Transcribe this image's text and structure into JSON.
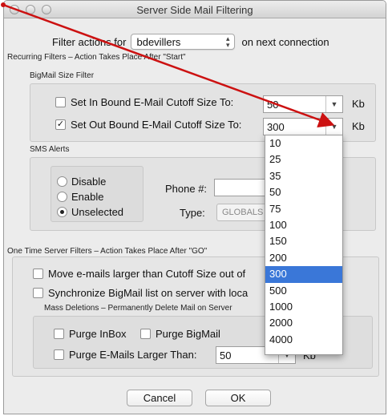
{
  "window": {
    "title": "Server Side Mail Filtering"
  },
  "filter_row": {
    "prefix": "Filter actions for",
    "account": "bdevillers",
    "suffix": "on next connection"
  },
  "recurring": {
    "heading": "Recurring Filters – Action Takes Place After \"Start\"",
    "size_filter": {
      "heading": "BigMail Size Filter",
      "in_label": "Set In Bound E-Mail Cutoff Size To:",
      "in_checked": false,
      "in_value": "50",
      "in_unit": "Kb",
      "out_label": "Set Out Bound E-Mail Cutoff Size To:",
      "out_checked": true,
      "out_value": "300",
      "out_unit": "Kb"
    },
    "sms": {
      "heading": "SMS Alerts",
      "options": [
        "Disable",
        "Enable",
        "Unselected"
      ],
      "selected": "Unselected",
      "phone_label": "Phone #:",
      "phone_value": "",
      "type_label": "Type:",
      "type_value": "GLOBALS"
    }
  },
  "one_time": {
    "heading": "One Time Server Filters  – Action Takes Place After \"GO\"",
    "move_label": "Move e-mails larger than Cutoff Size out of",
    "sync_label": "Synchronize BigMail list on server with loca",
    "mass": {
      "heading": "Mass Deletions – Permanently Delete Mail on Server",
      "purge_inbox": "Purge InBox",
      "purge_bigmail": "Purge BigMail",
      "purge_larger": "Purge E-Mails Larger Than:",
      "purge_value": "50",
      "purge_unit": "Kb"
    }
  },
  "buttons": {
    "cancel": "Cancel",
    "ok": "OK"
  },
  "dropdown": {
    "options": [
      "10",
      "25",
      "35",
      "50",
      "75",
      "100",
      "150",
      "200",
      "300",
      "500",
      "1000",
      "2000",
      "4000"
    ],
    "selected": "300"
  },
  "annotation": {
    "arrow_color": "#cc1111"
  }
}
